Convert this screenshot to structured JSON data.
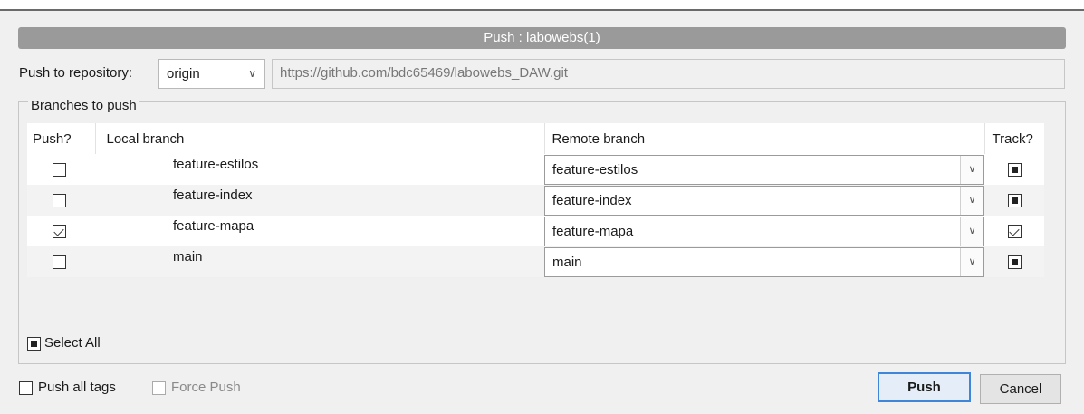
{
  "top_strip_text": "",
  "dialog": {
    "title": "Push : labowebs(1)"
  },
  "repository": {
    "label": "Push to repository:",
    "selected": "origin",
    "url": "https://github.com/bdc65469/labowebs_DAW.git"
  },
  "branches_group": {
    "label": "Branches to push",
    "columns": {
      "push": "Push?",
      "local": "Local branch",
      "remote": "Remote branch",
      "track": "Track?"
    },
    "rows": [
      {
        "push_checked": false,
        "local": "feature-estilos",
        "remote": "feature-estilos",
        "track": "indeterminate"
      },
      {
        "push_checked": false,
        "local": "feature-index",
        "remote": "feature-index",
        "track": "indeterminate"
      },
      {
        "push_checked": true,
        "local": "feature-mapa",
        "remote": "feature-mapa",
        "track": "checked"
      },
      {
        "push_checked": false,
        "local": "main",
        "remote": "main",
        "track": "indeterminate"
      }
    ],
    "select_all_label": "Select All"
  },
  "options": {
    "push_all_tags_label": "Push all tags",
    "force_push_label": "Force Push"
  },
  "buttons": {
    "push": "Push",
    "cancel": "Cancel"
  },
  "colors": {
    "focus_border": "#3f86d8",
    "title_bar": "#9a9a9a"
  },
  "icons": {
    "dropdown": "chevron-down-icon"
  }
}
